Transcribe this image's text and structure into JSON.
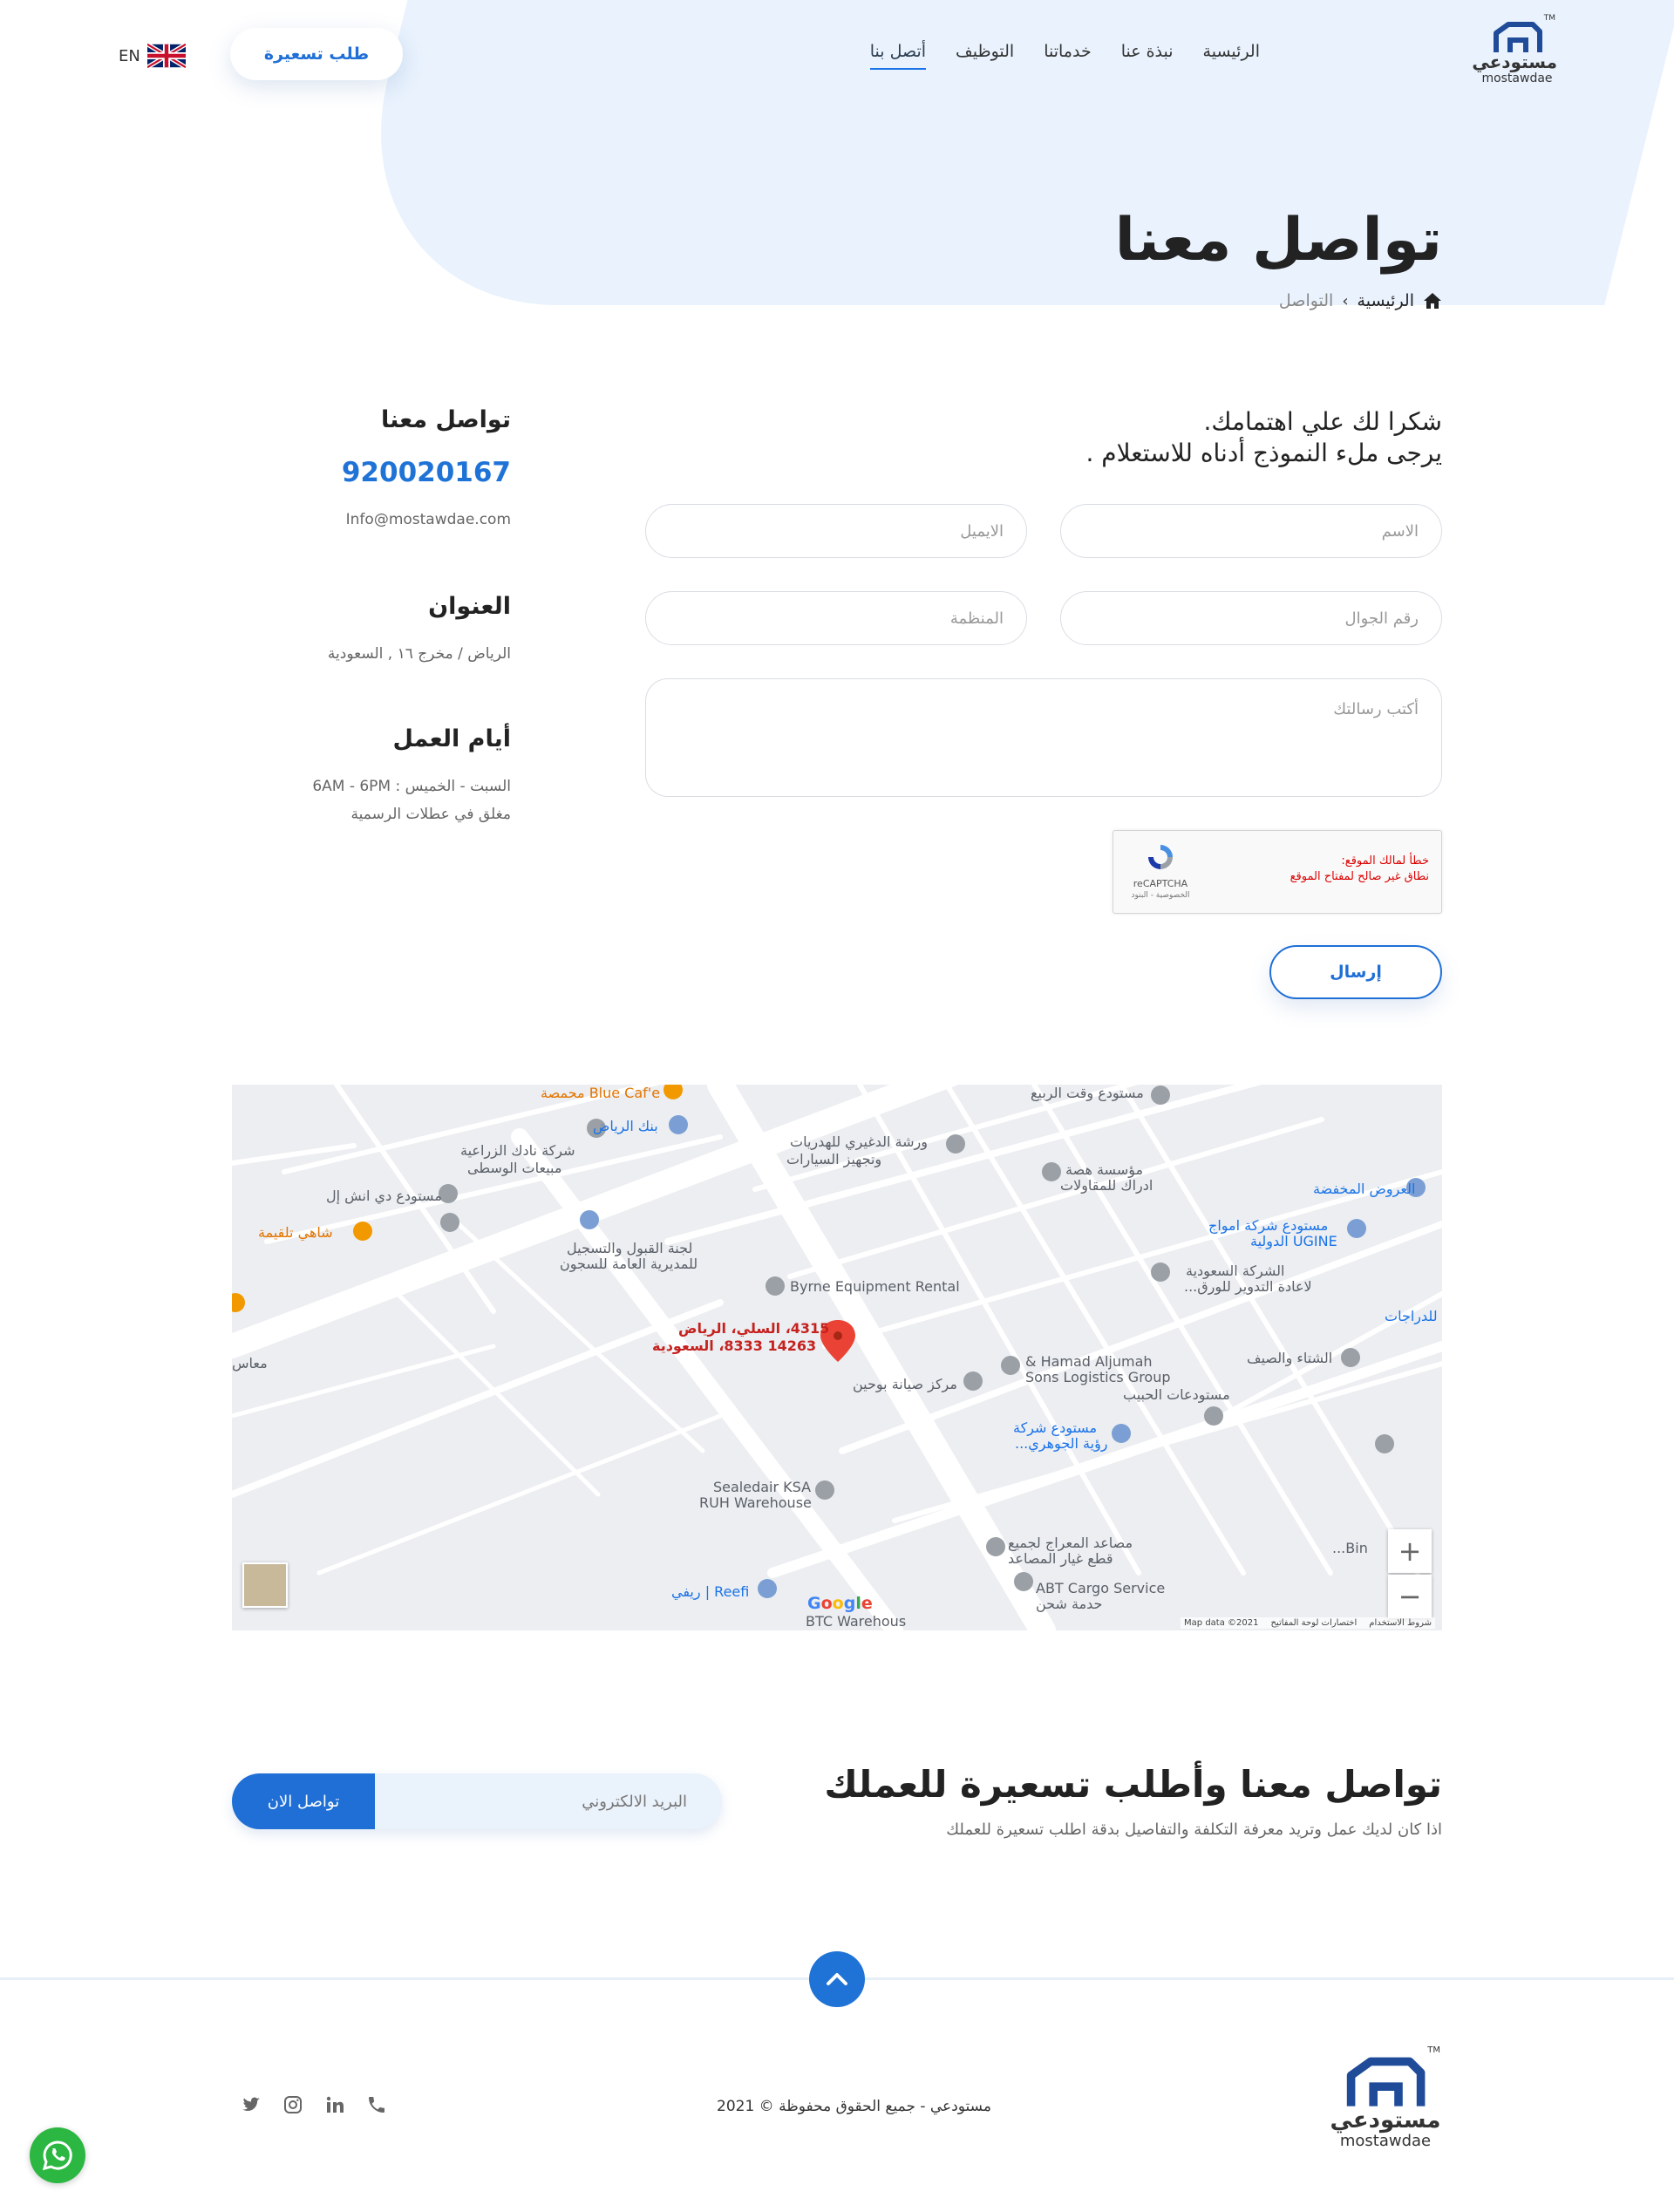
{
  "header": {
    "logo_ar": "مستودعي",
    "logo_en": "mostawdae",
    "logo_tm": "TM",
    "nav": [
      "الرئيسية",
      "نبذة عنا",
      "خدماتنا",
      "التوظيف",
      "أتصل بنا"
    ],
    "active_nav": "أتصل بنا",
    "quote_button": "طلب تسعيرة",
    "lang": "EN"
  },
  "page": {
    "title": "تواصل معنا",
    "breadcrumb": {
      "home": "الرئيسية",
      "current": "التواصل"
    }
  },
  "form": {
    "intro_line1": "شكرا لك علي اهتمامك.",
    "intro_line2": "يرجى ملء النموذج أدناه للاستعلام .",
    "placeholders": {
      "name": "الاسم",
      "email": "الايميل",
      "mobile": "رقم الجوال",
      "organization": "المنظمة",
      "message": "أكتب رسالتك"
    },
    "recaptcha": {
      "error_line1": "خطأ لمالك الموقع:",
      "error_line2": "نطاق غير صالح لمفتاح الموقع",
      "brand": "reCAPTCHA",
      "links": "الخصوصية - البنود"
    },
    "submit": "إرسال"
  },
  "contact": {
    "heading": "تواصل معنا",
    "phone": "920020167",
    "email": "Info@mostawdae.com",
    "address_heading": "العنوان",
    "address": "الرياض / مخرج ١٦ , السعودية",
    "hours_heading": "أيام العمل",
    "hours_line1": "السبت - الخميس : 6AM - 6PM",
    "hours_line2": "مغلق في عطلات الرسمية"
  },
  "map": {
    "pin_line1": "4315، السلي، الرياض",
    "pin_line2": "14263 8333، السعودية",
    "places": [
      "Blue Caf'e محمصة",
      "مستودع وقت الربيع",
      "بنك الرياض",
      "شركة نادك الزراعية",
      "مبيعات الوسطى",
      "ورشة الدغيري للهدريات",
      "وتجهيز السيارات",
      "مؤسسة هصة",
      "ادراك للمقاولات",
      "العروض المخفضة",
      "مستودع دي انش إل",
      "شاهي تلقيمة",
      "لجنة القبول والتسجيل",
      "للمديرية العامة للسجون",
      "مستودع شركة امواج",
      "UGINE الدولية",
      "الشركة السعودية",
      "لاعادة التدوير للورق...",
      "Byrne Equipment Rental",
      "للدراجات",
      "الشتاء والصيف",
      "Hamad Aljumah &",
      "Sons Logistics Group",
      "مركز صيانة بوحين",
      "مستودعات الحبيب",
      "مستودع شركة",
      "رؤية الجوهري...",
      "Sealedair KSA",
      "RUH Warehouse",
      "مصاعد المعراج لجميع",
      "قطع غيار المصاعد",
      "ABT Cargo Service",
      "حدمة شحن",
      "Reefi | ريفي",
      "BTC Warehous",
      "Bin...",
      "معاس"
    ],
    "zoom_in": "+",
    "zoom_out": "−",
    "google": "Google",
    "footer_links": [
      "Map data ©2021",
      "اختصارات لوحة المفاتيح",
      "شروط الاستخدام"
    ]
  },
  "cta": {
    "title": "تواصل معنا وأطلب تسعيرة للعملك",
    "subtitle": "اذا كان لديك عمل وتريد معرفة التكلفة والتفاصيل بدقة اطلب تسعيرة للعملك",
    "email_placeholder": "البريد الالكتروني",
    "button": "تواصل الان"
  },
  "footer": {
    "copyright": "مستودعي - جميع الحقوق محفوظة © 2021",
    "socials": [
      "phone-icon",
      "linkedin-icon",
      "instagram-icon",
      "twitter-icon"
    ]
  },
  "colors": {
    "primary": "#1f6fd6",
    "hero_bg": "#e9f2fd",
    "whatsapp": "#2bb741"
  }
}
